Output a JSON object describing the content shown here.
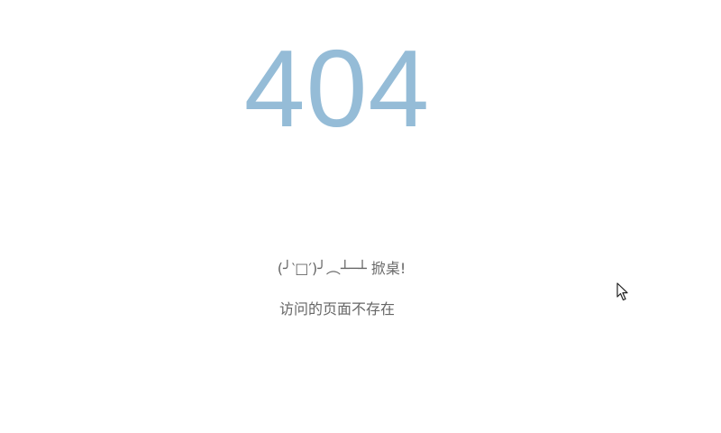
{
  "error": {
    "code": "404",
    "kaomoji": "(╯‵□′)╯︵┴─┴ 掀桌!",
    "message": "访问的页面不存在"
  },
  "colors": {
    "code": "#95bcd7",
    "text": "#666666",
    "background": "#ffffff"
  },
  "icons": {
    "cursor": "mouse-pointer-icon"
  }
}
